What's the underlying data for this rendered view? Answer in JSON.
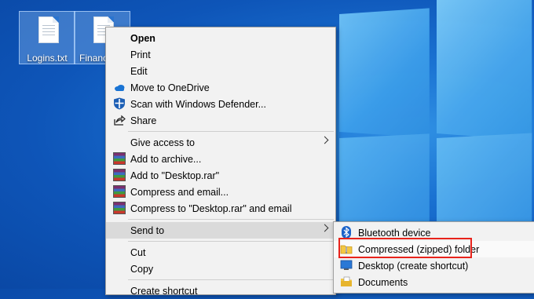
{
  "desktop": {
    "icons": [
      {
        "label": "Logins.txt"
      },
      {
        "label": "Finance"
      }
    ]
  },
  "context_menu": {
    "items": [
      {
        "label": "Open",
        "icon": "none"
      },
      {
        "label": "Print",
        "icon": "none"
      },
      {
        "label": "Edit",
        "icon": "none"
      },
      {
        "label": "Move to OneDrive",
        "icon": "onedrive-icon"
      },
      {
        "label": "Scan with Windows Defender...",
        "icon": "defender-shield-icon"
      },
      {
        "label": "Share",
        "icon": "share-icon"
      },
      {
        "label": "Give access to",
        "icon": "none",
        "submenu": true
      },
      {
        "label": "Add to archive...",
        "icon": "winrar-icon"
      },
      {
        "label": "Add to \"Desktop.rar\"",
        "icon": "winrar-icon"
      },
      {
        "label": "Compress and email...",
        "icon": "winrar-icon"
      },
      {
        "label": "Compress to \"Desktop.rar\" and email",
        "icon": "winrar-icon"
      },
      {
        "label": "Send to",
        "icon": "none",
        "submenu": true,
        "highlighted": true
      },
      {
        "label": "Cut",
        "icon": "none"
      },
      {
        "label": "Copy",
        "icon": "none"
      },
      {
        "label": "Create shortcut",
        "icon": "none"
      }
    ]
  },
  "send_to_submenu": {
    "items": [
      {
        "label": "Bluetooth device",
        "icon": "bluetooth-icon"
      },
      {
        "label": "Compressed (zipped) folder",
        "icon": "zip-folder-icon",
        "annotated": true
      },
      {
        "label": "Desktop (create shortcut)",
        "icon": "desktop-icon"
      },
      {
        "label": "Documents",
        "icon": "documents-icon"
      }
    ]
  },
  "colors": {
    "annotation_red": "#e8231b",
    "menu_bg": "#f2f2f2",
    "highlight_bg": "#dadada",
    "desktop_blue": "#1a72d2"
  }
}
